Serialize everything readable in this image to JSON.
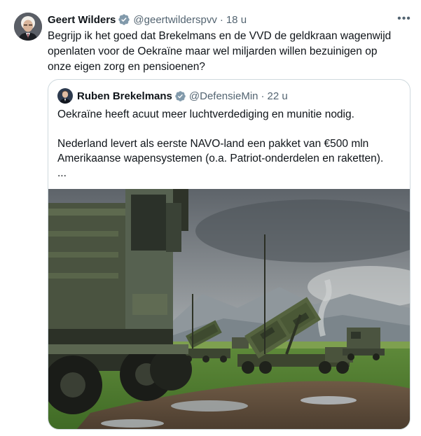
{
  "tweet": {
    "author_name": "Geert Wilders",
    "handle": "@geertwilderspvv",
    "separator": "·",
    "time": "18 u",
    "more_label": "•••",
    "text": "Begrijp ik het goed dat Brekelmans en de VVD de geldkraan wagenwijd openlaten voor de Oekraïne maar wel miljarden willen bezuinigen op onze eigen zorg en pensioenen?"
  },
  "quoted": {
    "author_name": "Ruben Brekelmans",
    "handle": "@DefensieMin",
    "separator": "·",
    "time": "22 u",
    "line1": "Oekraïne heeft acuut meer luchtverdediging en munitie nodig.",
    "line2": "Nederland levert als eerste NAVO-land een pakket van €500 mln Amerikaanse wapensystemen (o.a. Patriot-onderdelen en raketten).",
    "line3": "...",
    "media_alt": "Military trucks and Patriot missile launchers on a grassy field under a cloudy sky"
  },
  "colors": {
    "text_primary": "#0f1419",
    "text_secondary": "#536471",
    "verified_badge": "#829aab",
    "border": "#cfd9de"
  },
  "icons": {
    "verified": "verified-badge-icon",
    "more": "more-options-icon"
  }
}
